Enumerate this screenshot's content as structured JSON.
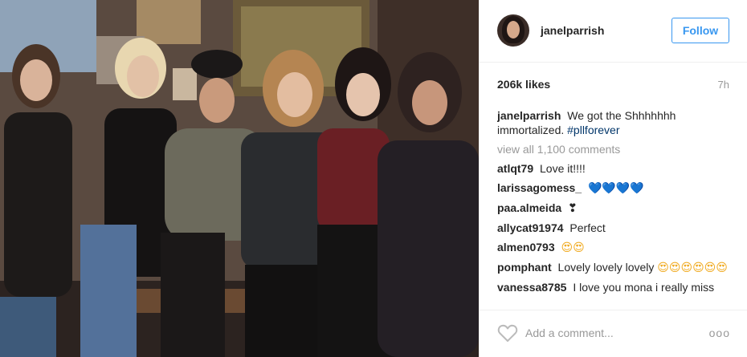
{
  "post": {
    "photo_alt": "Group photo of five women making a shush gesture",
    "author": {
      "username": "janelparrish",
      "follow_label": "Follow"
    },
    "likes": "206k likes",
    "time_ago": "7h",
    "caption": {
      "user": "janelparrish",
      "text": "We got the Shhhhhhh immortalized.",
      "hashtag": "#pllforever"
    },
    "view_all_comments": "view all 1,100 comments",
    "comments": [
      {
        "user": "atlqt79",
        "text": "Love it!!!!",
        "emoji": "",
        "emoji_kind": ""
      },
      {
        "user": "larissagomess_",
        "text": "",
        "emoji": "💙💙💙💙",
        "emoji_kind": "hearts"
      },
      {
        "user": "paa.almeida",
        "text": "",
        "emoji": "❣",
        "emoji_kind": ""
      },
      {
        "user": "allycat91974",
        "text": "Perfect",
        "emoji": "",
        "emoji_kind": ""
      },
      {
        "user": "almen0793",
        "text": "",
        "emoji": "😍😍",
        "emoji_kind": "smiles"
      },
      {
        "user": "pomphant",
        "text": "Lovely lovely lovely",
        "emoji": "😍😍😍😍😍😍",
        "emoji_kind": "smiles"
      },
      {
        "user": "vanessa8785",
        "text": "I love you mona i really miss",
        "emoji": "",
        "emoji_kind": ""
      }
    ],
    "add_comment_placeholder": "Add a comment...",
    "more_label": "ooo",
    "colors": {
      "accent": "#3897f0",
      "hashtag": "#003569",
      "muted": "#999999",
      "border": "#efefef"
    }
  }
}
